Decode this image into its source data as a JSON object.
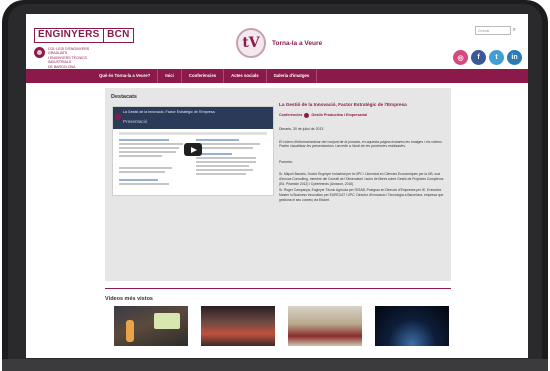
{
  "header": {
    "logo_left": "ENGINYERS",
    "logo_right": "BCN",
    "logo_sub": [
      "COL·LEGI D'ENGINYERS GRADUATS",
      "I ENGINYERS TÈCNICS INDUSTRIALS",
      "DE BARCELONA"
    ],
    "tv_mark": "tV",
    "tv_title": "Torna-la a Veure",
    "search_placeholder": "Cercar",
    "search_icon": "magnifier-icon"
  },
  "socials": [
    {
      "name": "instagram-icon",
      "glyph": "◎",
      "color": "#d6497d"
    },
    {
      "name": "facebook-icon",
      "glyph": "f",
      "color": "#3b5998"
    },
    {
      "name": "twitter-icon",
      "glyph": "t",
      "color": "#3ea0d6"
    },
    {
      "name": "linkedin-icon",
      "glyph": "in",
      "color": "#2a79b8"
    }
  ],
  "nav": [
    "Què és Torna-la a Veure?",
    "Inici",
    "Conferències",
    "Actes socials",
    "Galeria d'imatges"
  ],
  "main": {
    "section_title": "Destacats",
    "video": {
      "top_title": "La Gestió de la Innovació, Factor Estratègic de l'Empresa",
      "top_sub": "Presentació"
    },
    "article": {
      "title": "La Gestió de la Innovació, Factor Estratègic de l'Empresa",
      "category_1": "Conferències",
      "category_2": "Gestió Productiva i Empresarial",
      "date": "Dimarts, 30 de juliol de 2013",
      "para": "Et volem d'informar/animar del conjunt de la jornada, en aquesta pàgina trobareu les imatges i els vídeos. Podeu visualitzar les presentacions i accedir a l'àudi de les ponències realitzades.",
      "invite": "Ponents:",
      "bio_1": "Sr. Miquel Barceló, Doctor Enginyer Industrial per la UPC i Llicenciat en Ciències Econòmiques per la UB, soci d'Innova Consulting, membre del Consell de l'Observatori i autor de llibres sobre Gestió de Projectes Complexos (Ed. Pirámide 2012) i Cybertrends (Amazon, 2016).",
      "bio_2": "Sr. Roger Campanyà, Enginyer Tècnic Agrícola per l'ESAB, Postgrau en Direcció d'Empreses per IE, Executive Master in Business Innovation per EURECAT i UPC. Director d'Innovació i Tecnologia a Barcelona, empresa que gestiona el seu comerç via Eticket."
    }
  },
  "videos_title": "Vídeos més vistos"
}
